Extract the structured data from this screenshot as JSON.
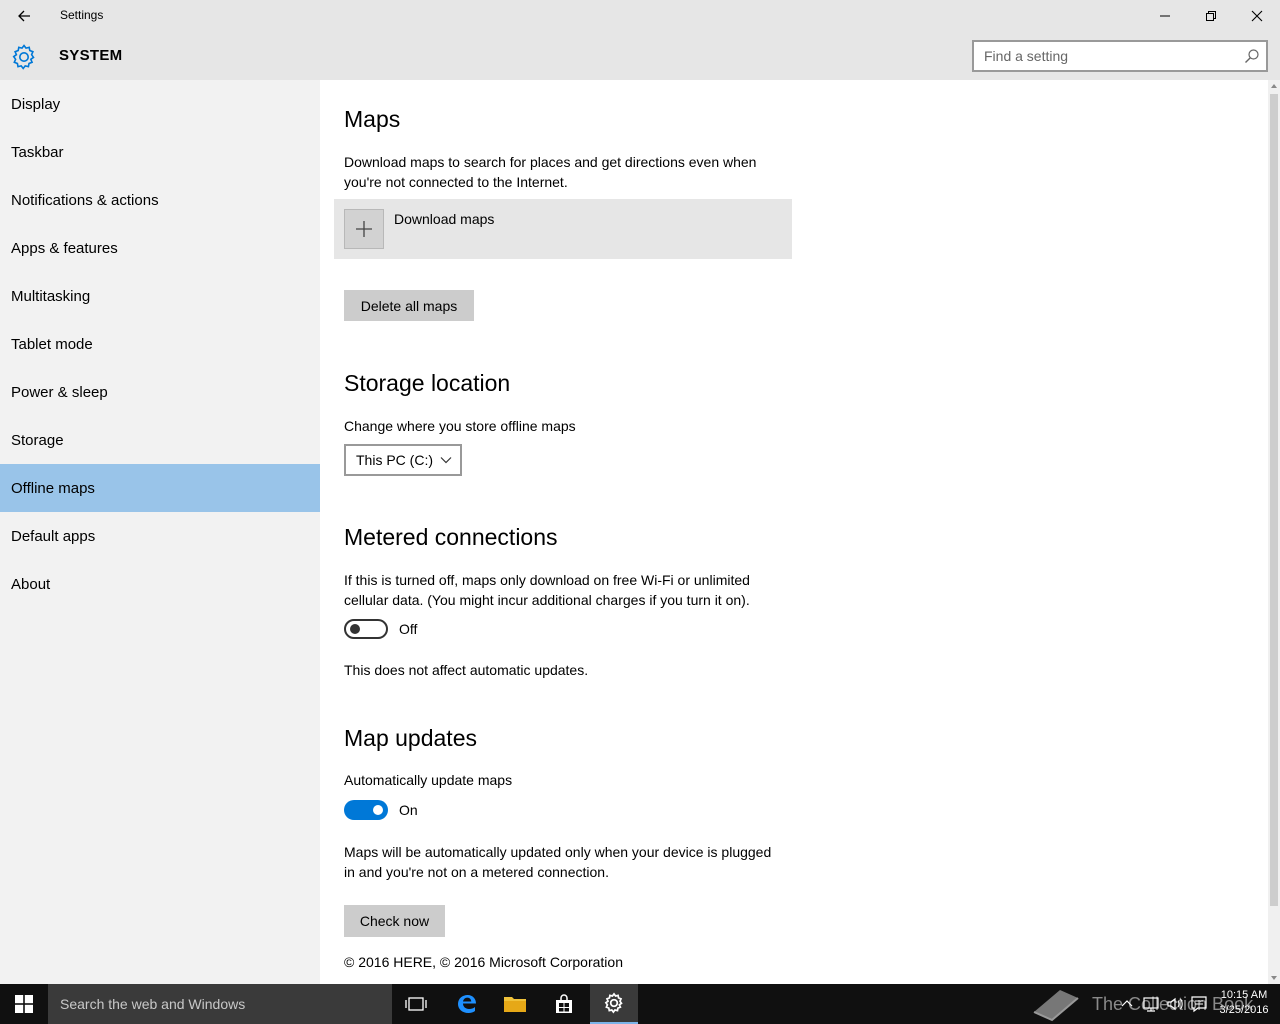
{
  "window": {
    "title": "Settings"
  },
  "header": {
    "section": "SYSTEM",
    "search_placeholder": "Find a setting"
  },
  "sidebar": {
    "items": [
      {
        "label": "Display"
      },
      {
        "label": "Taskbar"
      },
      {
        "label": "Notifications & actions"
      },
      {
        "label": "Apps & features"
      },
      {
        "label": "Multitasking"
      },
      {
        "label": "Tablet mode"
      },
      {
        "label": "Power & sleep"
      },
      {
        "label": "Storage"
      },
      {
        "label": "Offline maps"
      },
      {
        "label": "Default apps"
      },
      {
        "label": "About"
      }
    ],
    "active": "Offline maps"
  },
  "maps": {
    "heading": "Maps",
    "description": "Download maps to search for places and get directions even when you're not connected to the Internet.",
    "download_label": "Download maps",
    "delete_label": "Delete all maps"
  },
  "storage": {
    "heading": "Storage location",
    "description": "Change where you store offline maps",
    "selected": "This PC (C:)"
  },
  "metered": {
    "heading": "Metered connections",
    "description": "If this is turned off, maps only download on free Wi-Fi or unlimited cellular data. (You might incur additional charges if you turn it on).",
    "toggle_state": "Off",
    "note": "This does not affect automatic updates."
  },
  "updates": {
    "heading": "Map updates",
    "description": "Automatically update maps",
    "toggle_state": "On",
    "note": "Maps will be automatically updated only when your device is plugged in and you're not on a metered connection.",
    "check_label": "Check now"
  },
  "copyright": "© 2016 HERE, © 2016 Microsoft Corporation",
  "taskbar": {
    "search_placeholder": "Search the web and Windows",
    "time": "10:15 AM",
    "date": "3/25/2016",
    "watermark": "The Collection Book"
  },
  "colors": {
    "accent": "#0078d7",
    "selected_nav": "#99c4e9",
    "chrome": "#e6e6e6",
    "sidebar": "#f2f2f2"
  }
}
